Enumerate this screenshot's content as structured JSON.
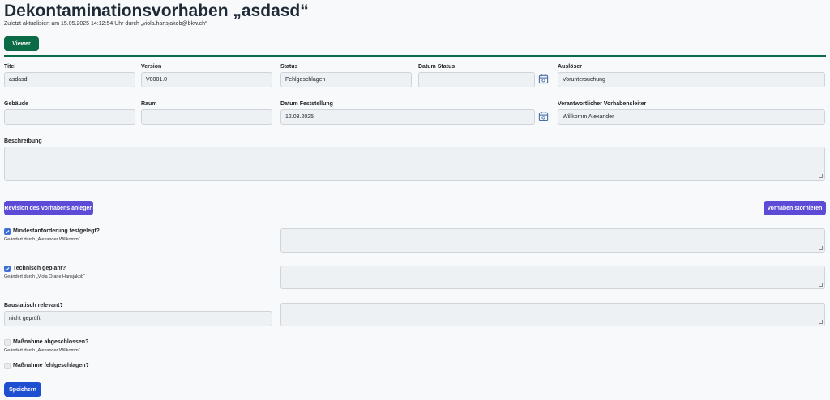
{
  "header": {
    "title": "Dekontaminationsvorhaben „asdasd“",
    "subtitle": "Zuletzt aktualisiert am 15.05.2025 14:12:54 Uhr durch „viola.hansjakob@bkw.ch“",
    "viewer_button": "Viewer"
  },
  "fields": {
    "titel": {
      "label": "Titel",
      "value": "asdasd"
    },
    "version": {
      "label": "Version",
      "value": "V0001.0"
    },
    "status": {
      "label": "Status",
      "value": "Fehlgeschlagen"
    },
    "datum_status": {
      "label": "Datum Status",
      "value": ""
    },
    "ausloeser": {
      "label": "Auslöser",
      "value": "Voruntersuchung"
    },
    "gebaeude": {
      "label": "Gebäude",
      "value": ""
    },
    "raum": {
      "label": "Raum",
      "value": ""
    },
    "datum_feststellung": {
      "label": "Datum Feststellung",
      "value": "12.03.2025"
    },
    "vorhabensleiter": {
      "label": "Verantwortlicher Vorhabensleiter",
      "value": "Willkomm Alexander"
    },
    "beschreibung": {
      "label": "Beschreibung",
      "value": ""
    }
  },
  "actions": {
    "revision_button": "Revision des Vorhabens anlegen",
    "stornieren_button": "Vorhaben stornieren",
    "save_button": "Speichern"
  },
  "checks": {
    "mindest": {
      "label": "Mindestanforderung festgelegt?",
      "checked": true,
      "changed_by": "Geändert durch „Alexander Willkomm“"
    },
    "technisch": {
      "label": "Technisch geplant?",
      "checked": true,
      "changed_by": "Geändert durch „Viola Orane Hansjakob“"
    },
    "baustatisch": {
      "label": "Baustatisch relevant?",
      "value": "nicht geprüft"
    },
    "abgeschlossen": {
      "label": "Maßnahme abgeschlossen?",
      "checked": false,
      "changed_by": "Geändert durch „Alexander Willkomm“"
    },
    "fehlgeschlagen": {
      "label": "Maßnahme fehlgeschlagen?",
      "checked": false
    }
  },
  "colors": {
    "primary_green": "#0b6b46",
    "purple": "#5b4bd6",
    "blue": "#1f4fd1",
    "checkbox_blue": "#3f6fd8"
  },
  "icons": [
    "calendar-icon",
    "check-icon"
  ]
}
